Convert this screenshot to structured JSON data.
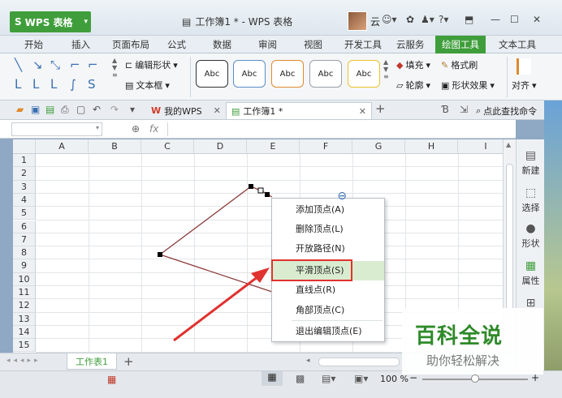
{
  "titlebar": {
    "app_name": "WPS 表格",
    "doc_title": "工作簿1 * - WPS 表格",
    "user": "云"
  },
  "tabs": [
    "开始",
    "插入",
    "页面布局",
    "公式",
    "数据",
    "审阅",
    "视图",
    "开发工具",
    "云服务",
    "绘图工具",
    "文本工具"
  ],
  "active_tab": "绘图工具",
  "ribbon": {
    "edit_shape": "编辑形状",
    "text_box": "文本框",
    "style_labels": [
      "Abc",
      "Abc",
      "Abc",
      "Abc",
      "Abc"
    ],
    "style_colors": [
      "#333333",
      "#5b8ec7",
      "#e08a2c",
      "#9aa0a6",
      "#e9c22b"
    ],
    "fill": "填充",
    "outline": "轮廓",
    "format_brush": "格式刷",
    "shape_effects": "形状效果",
    "align": "对齐"
  },
  "quickbar": {
    "my_wps": "我的WPS",
    "doc_tab": "工作簿1 *",
    "search": "点此查找命令"
  },
  "formula": {
    "fx": "fx"
  },
  "columns": [
    "A",
    "B",
    "C",
    "D",
    "E",
    "F",
    "G",
    "H",
    "I"
  ],
  "rows": [
    "1",
    "2",
    "3",
    "4",
    "5",
    "6",
    "7",
    "8",
    "9",
    "10",
    "11",
    "12",
    "13",
    "14",
    "15"
  ],
  "context_menu": {
    "items": [
      "添加顶点(A)",
      "删除顶点(L)",
      "开放路径(N)",
      "平滑顶点(S)",
      "直线点(R)",
      "角部顶点(C)",
      "退出编辑顶点(E)"
    ],
    "highlighted": "平滑顶点(S)"
  },
  "right_panel": [
    "新建",
    "选择",
    "形状",
    "属性"
  ],
  "sheet": {
    "tab": "工作表1"
  },
  "status": {
    "zoom": "100 %"
  },
  "watermark": {
    "title": "百科全说",
    "subtitle": "助你轻松解决"
  },
  "colors": {
    "accent_green": "#3f9e3b",
    "highlight_red": "#e0322f",
    "line_brown": "#8b3a3a"
  }
}
